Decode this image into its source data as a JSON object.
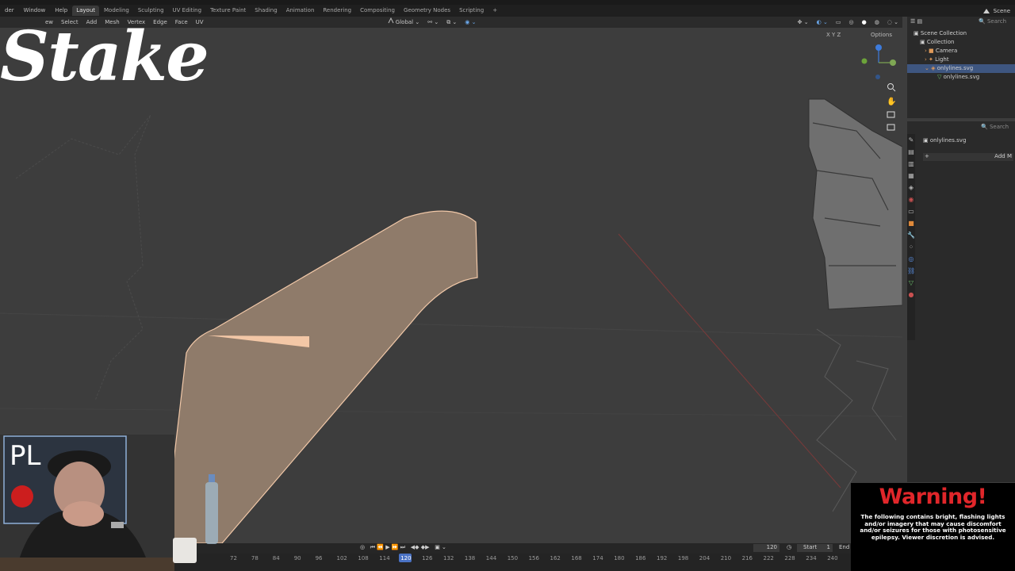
{
  "menubar": {
    "items": [
      "der",
      "Window",
      "Help"
    ],
    "workspaces": [
      "Layout",
      "Modeling",
      "Sculpting",
      "UV Editing",
      "Texture Paint",
      "Shading",
      "Animation",
      "Rendering",
      "Compositing",
      "Geometry Nodes",
      "Scripting"
    ],
    "active_workspace": "Layout",
    "add_tab": "+",
    "scene_label": "Scene"
  },
  "viewport_header": {
    "items": [
      "ew",
      "Select",
      "Add",
      "Mesh",
      "Vertex",
      "Edge",
      "Face",
      "UV"
    ],
    "transform_orientation": "Global",
    "axes": "X Y Z",
    "options_label": "Options"
  },
  "overlay": {
    "logo_text": "Stake",
    "webcam_sign": "PL"
  },
  "outliner": {
    "search_placeholder": "Search",
    "rows": [
      {
        "label": "Scene Collection",
        "icon": "collection-icon"
      },
      {
        "label": "Collection",
        "icon": "collection-icon"
      },
      {
        "label": "Camera",
        "icon": "camera-icon"
      },
      {
        "label": "Light",
        "icon": "light-icon"
      },
      {
        "label": "onlylines.svg",
        "icon": "curve-icon"
      },
      {
        "label": "onlylines.svg",
        "icon": "mesh-data-icon"
      }
    ]
  },
  "properties": {
    "search_placeholder": "Search",
    "object_name": "onlylines.svg",
    "add_modifier": "Add M"
  },
  "timeline": {
    "current_frame": "120",
    "start_label": "Start",
    "start_value": "1",
    "end_label": "End",
    "ticks": [
      "72",
      "78",
      "84",
      "90",
      "96",
      "102",
      "108",
      "114",
      "120",
      "126",
      "132",
      "138",
      "144",
      "150",
      "156",
      "162",
      "168",
      "174",
      "180",
      "186",
      "192",
      "198",
      "204",
      "210",
      "216",
      "222",
      "228",
      "234",
      "240"
    ]
  },
  "warning": {
    "title": "Warning!",
    "body": "The following contains bright, flashing lights and/or imagery that may cause discomfort and/or seizures for those with photosensitive epilepsy. Viewer discretion is advised."
  },
  "colors": {
    "mesh_face": "#8f7b6a",
    "mesh_highlight": "#f3c7a6",
    "selection": "#3e5680",
    "warning_red": "#e0262a"
  }
}
